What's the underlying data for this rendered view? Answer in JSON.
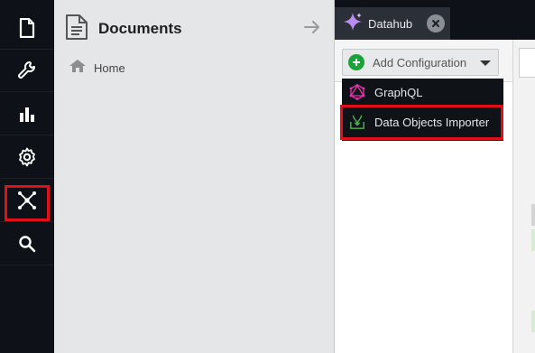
{
  "rail": {
    "items": [
      {
        "icon": "document-icon"
      },
      {
        "icon": "wrench-icon"
      },
      {
        "icon": "bar-chart-icon"
      },
      {
        "icon": "gear-icon"
      },
      {
        "icon": "datahub-network-icon",
        "highlighted": true
      },
      {
        "icon": "search-icon"
      }
    ]
  },
  "tree": {
    "title": "Documents",
    "home_label": "Home"
  },
  "tabs": [
    {
      "label": "Datahub"
    }
  ],
  "toolbar": {
    "add_label": "Add Configuration"
  },
  "menu": {
    "items": [
      {
        "label": "GraphQL",
        "icon": "graphql-icon"
      },
      {
        "label": "Data Objects Importer",
        "icon": "importer-icon",
        "highlighted": true
      }
    ]
  },
  "colors": {
    "rail_bg": "#0e1117",
    "highlight": "#e0101a",
    "plus_green": "#1aa33a",
    "graphql_pink": "#e535ab",
    "importer_green": "#4caf50"
  }
}
